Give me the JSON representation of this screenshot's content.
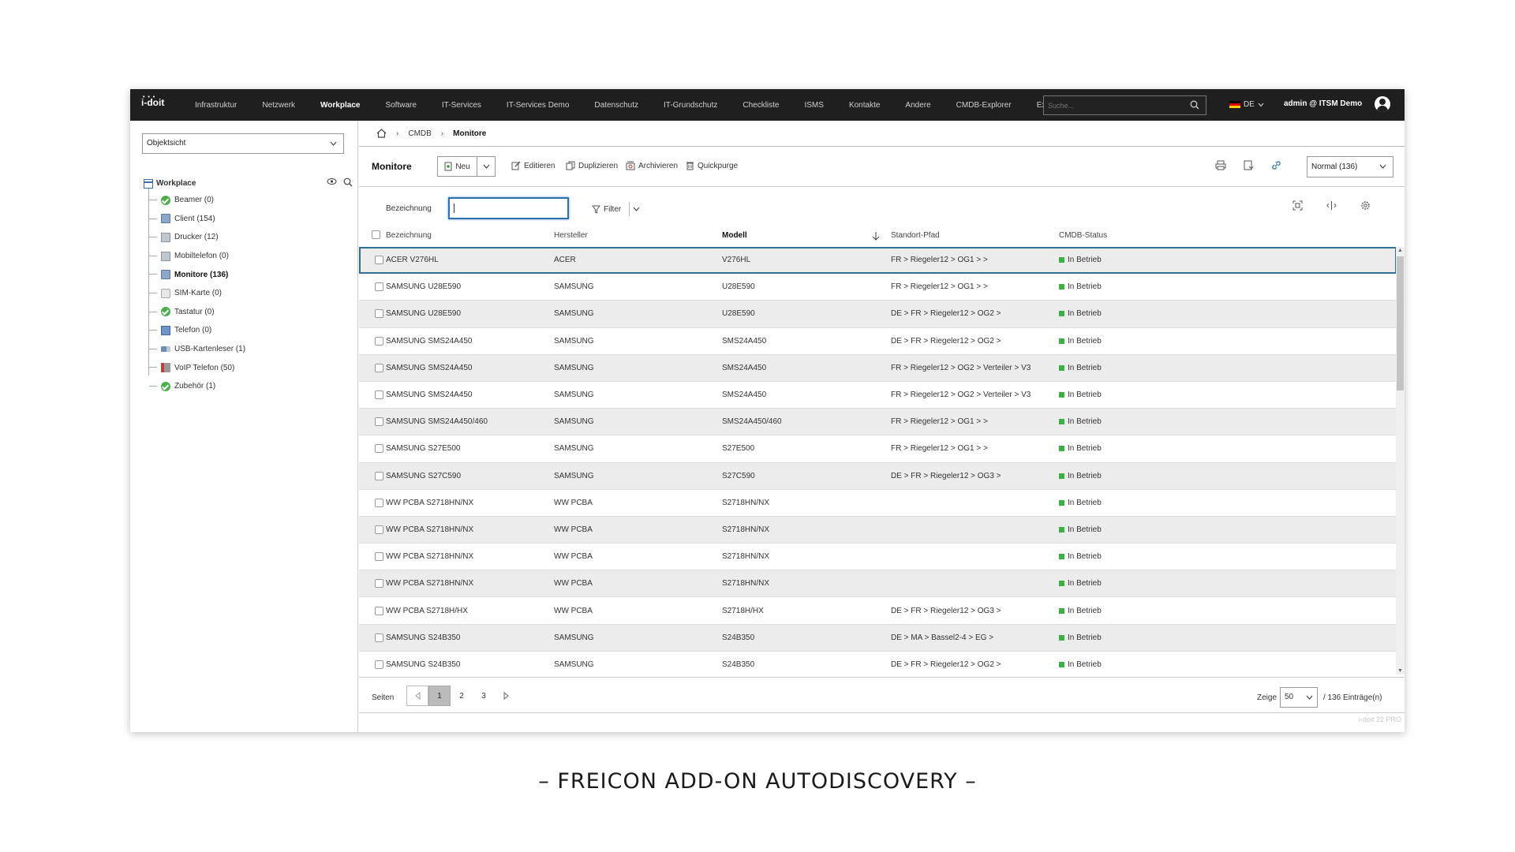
{
  "topbar": {
    "logo": "i-doit",
    "nav": [
      "Infrastruktur",
      "Netzwerk",
      "Workplace",
      "Software",
      "IT-Services",
      "IT-Services Demo",
      "Datenschutz",
      "IT-Grundschutz",
      "Checkliste",
      "ISMS",
      "Kontakte",
      "Andere",
      "CMDB-Explorer",
      "Extras"
    ],
    "active_nav": "Workplace",
    "search_placeholder": "Suche...",
    "language": "DE",
    "user": "admin @ ITSM Demo"
  },
  "sidebar": {
    "view_select": "Objektsicht",
    "root": "Workplace",
    "items": [
      {
        "label": "Beamer (0)",
        "icon": "check-icon"
      },
      {
        "label": "Client (154)",
        "icon": "client-icon"
      },
      {
        "label": "Drucker (12)",
        "icon": "printer-icon"
      },
      {
        "label": "Mobiltelefon (0)",
        "icon": "mobile-icon"
      },
      {
        "label": "Monitore (136)",
        "icon": "monitor-icon",
        "active": true
      },
      {
        "label": "SIM-Karte (0)",
        "icon": "sim-card-icon"
      },
      {
        "label": "Tastatur (0)",
        "icon": "check-icon"
      },
      {
        "label": "Telefon (0)",
        "icon": "phone-icon"
      },
      {
        "label": "USB-Kartenleser (1)",
        "icon": "usb-icon"
      },
      {
        "label": "VoIP Telefon (50)",
        "icon": "voip-icon"
      },
      {
        "label": "Zubehör (1)",
        "icon": "check-icon"
      }
    ]
  },
  "breadcrumb": [
    "CMDB",
    "Monitore"
  ],
  "toolbar": {
    "title": "Monitore",
    "new": "Neu",
    "edit": "Editieren",
    "duplicate": "Duplizieren",
    "archive": "Archivieren",
    "quickpurge": "Quickpurge",
    "list_view": "Normal (136)"
  },
  "filter": {
    "label": "Bezeichnung",
    "value": "",
    "button": "Filter"
  },
  "table": {
    "columns": [
      "Bezeichnung",
      "Hersteller",
      "Modell",
      "Standort-Pfad",
      "CMDB-Status"
    ],
    "rows": [
      [
        "ACER V276HL",
        "ACER",
        "V276HL",
        "FR > Riegeler12 > OG1 > >",
        "In Betrieb"
      ],
      [
        "SAMSUNG U28E590",
        "SAMSUNG",
        "U28E590",
        "FR > Riegeler12 > OG1 > >",
        "In Betrieb"
      ],
      [
        "SAMSUNG U28E590",
        "SAMSUNG",
        "U28E590",
        "DE > FR > Riegeler12 > OG2 >",
        "In Betrieb"
      ],
      [
        "SAMSUNG SMS24A450",
        "SAMSUNG",
        "SMS24A450",
        "DE > FR > Riegeler12 > OG2 >",
        "In Betrieb"
      ],
      [
        "SAMSUNG SMS24A450",
        "SAMSUNG",
        "SMS24A450",
        "FR > Riegeler12 > OG2 > Verteiler > V3",
        "In Betrieb"
      ],
      [
        "SAMSUNG SMS24A450",
        "SAMSUNG",
        "SMS24A450",
        "FR > Riegeler12 > OG2 > Verteiler > V3",
        "In Betrieb"
      ],
      [
        "SAMSUNG SMS24A450/460",
        "SAMSUNG",
        "SMS24A450/460",
        "FR > Riegeler12 > OG1 > >",
        "In Betrieb"
      ],
      [
        "SAMSUNG S27E500",
        "SAMSUNG",
        "S27E500",
        "FR > Riegeler12 > OG1 > >",
        "In Betrieb"
      ],
      [
        "SAMSUNG S27C590",
        "SAMSUNG",
        "S27C590",
        "DE > FR > Riegeler12 > OG3 >",
        "In Betrieb"
      ],
      [
        "WW PCBA S2718HN/NX",
        "WW PCBA",
        "S2718HN/NX",
        "",
        "In Betrieb"
      ],
      [
        "WW PCBA S2718HN/NX",
        "WW PCBA",
        "S2718HN/NX",
        "",
        "In Betrieb"
      ],
      [
        "WW PCBA S2718HN/NX",
        "WW PCBA",
        "S2718HN/NX",
        "",
        "In Betrieb"
      ],
      [
        "WW PCBA S2718HN/NX",
        "WW PCBA",
        "S2718HN/NX",
        "",
        "In Betrieb"
      ],
      [
        "WW PCBA S2718H/HX",
        "WW PCBA",
        "S2718H/HX",
        "DE > FR > Riegeler12 > OG3 >",
        "In Betrieb"
      ],
      [
        "SAMSUNG S24B350",
        "SAMSUNG",
        "S24B350",
        "DE > MA > Bassel2-4 > EG >",
        "In Betrieb"
      ],
      [
        "SAMSUNG S24B350",
        "SAMSUNG",
        "S24B350",
        "DE > FR > Riegeler12 > OG2 >",
        "In Betrieb"
      ]
    ]
  },
  "footer": {
    "pages_label": "Seiten",
    "pages": [
      "1",
      "2",
      "3"
    ],
    "show_label": "Zeige",
    "page_size": "50",
    "entries": "/ 136 Einträge(n)",
    "version": "i-doit 22 PRO"
  },
  "caption": "– FREICON ADD-ON AUTODISCOVERY –",
  "colors": {
    "topbar": "#1f1f1f",
    "status_green": "#3cb043",
    "focus_blue": "#2f6fae"
  }
}
